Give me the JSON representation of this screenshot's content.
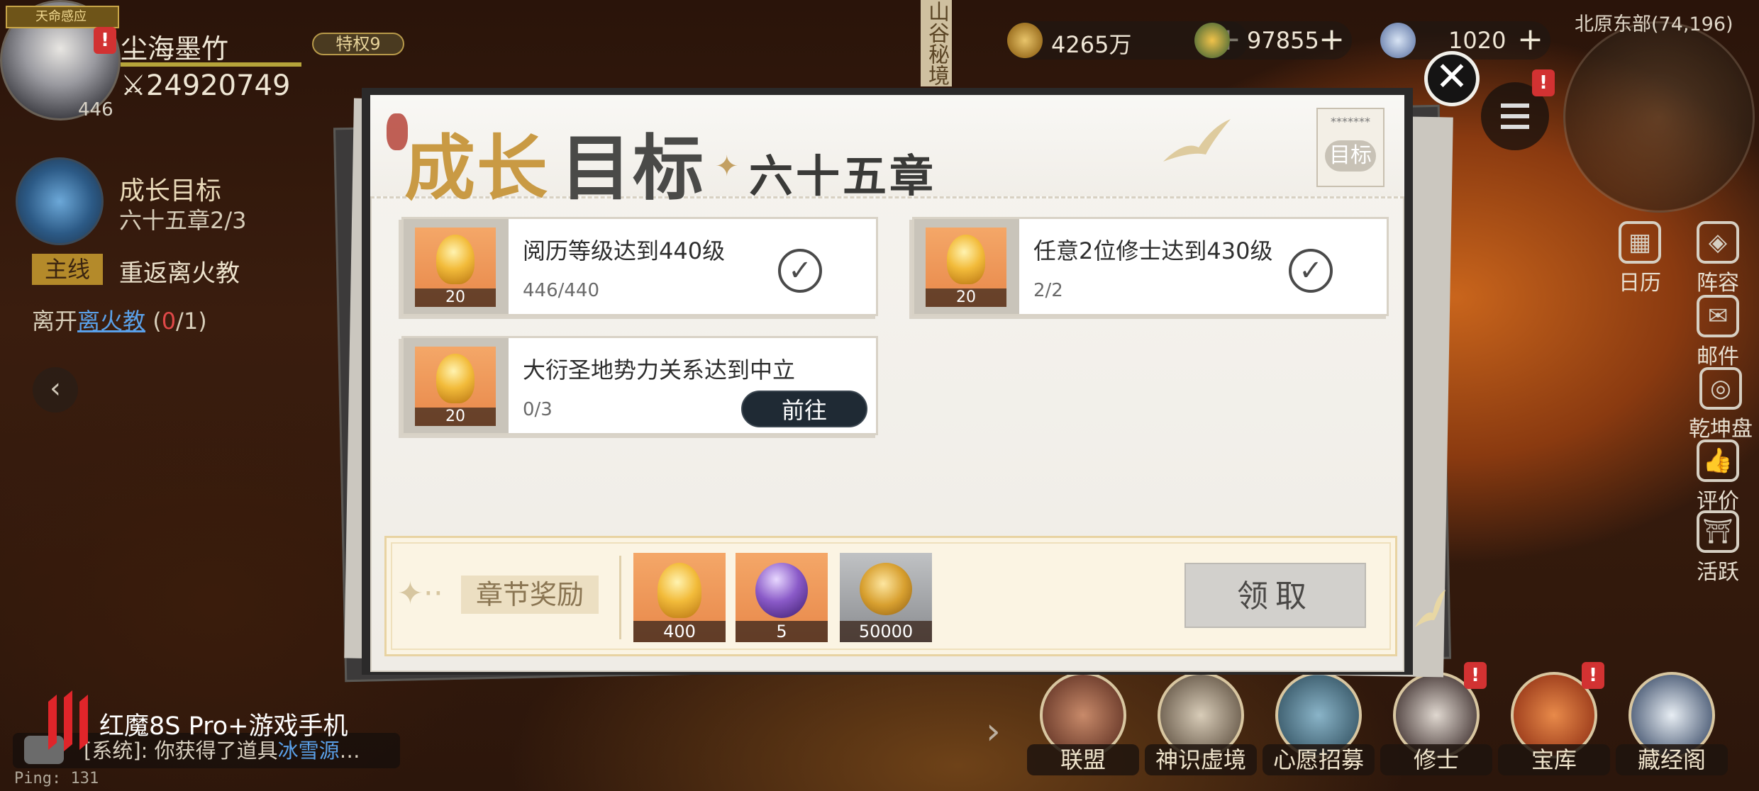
{
  "player": {
    "name": "尘海墨竹",
    "power": "24920749",
    "level": "446",
    "privilege": "特权9",
    "mini_badge": "天命感应"
  },
  "quest_tracker": {
    "title": "成长目标",
    "sub": "六十五章2/3",
    "main_tag": "主线",
    "main_text": "重返离火教",
    "leave_prefix": "离开",
    "leave_link": "离火教",
    "leave_count_open": "(",
    "leave_count_done": "0",
    "leave_count_rest": "/1)"
  },
  "top_bar": {
    "vertical_sign": "山谷秘境",
    "currency": [
      {
        "icon": "copper-coin-icon",
        "value": "4265万",
        "plus": "+"
      },
      {
        "icon": "spirit-stone-icon",
        "value": "97855",
        "plus": "+"
      },
      {
        "icon": "crystal-icon",
        "value": "1020",
        "plus": "+"
      }
    ],
    "location": "北原东部(74,196)",
    "alert": "!"
  },
  "side_menu": [
    {
      "icon": "calendar-icon",
      "glyph": "▦",
      "label": "日历"
    },
    {
      "icon": "formation-icon",
      "glyph": "◈",
      "label": "阵容"
    },
    {
      "icon": "mail-icon",
      "glyph": "✉",
      "label": "邮件"
    },
    {
      "icon": "universe-pouch-icon",
      "glyph": "◎",
      "label": "乾坤盘"
    },
    {
      "icon": "thumbs-up-icon",
      "glyph": "👍",
      "label": "评价"
    },
    {
      "icon": "pagoda-icon",
      "glyph": "⛩",
      "label": "活跃"
    }
  ],
  "bottom_menu": [
    {
      "name": "alliance",
      "label": "联盟",
      "color": "#8a4a3a"
    },
    {
      "name": "divine-sense",
      "label": "神识虚境",
      "color": "#7a6c5c"
    },
    {
      "name": "wish-recruit",
      "label": "心愿招募",
      "color": "#4a6a7a"
    },
    {
      "name": "cultivator",
      "label": "修士",
      "color": "#5a4c4a"
    },
    {
      "name": "treasury",
      "label": "宝库",
      "color": "#a8502a"
    },
    {
      "name": "scripture-pavilion",
      "label": "藏经阁",
      "color": "#5a6a84"
    }
  ],
  "chat": {
    "prefix": "[系统]: 你获得了道具",
    "item": "冰雪源",
    "ellipsis": "…"
  },
  "ping": "Ping: 131",
  "brand": "红魔8S Pro+游戏手机",
  "modal": {
    "title_a": "成长",
    "title_b": "目标",
    "star": "✦",
    "chapter": "六十五章",
    "stamp_stars": "*******",
    "stamp_text": "目标",
    "close": "✕",
    "tasks": [
      {
        "name": "阅历等级达到440级",
        "progress": "446/440",
        "reward_qty": "20",
        "status": "done",
        "check": "✓"
      },
      {
        "name": "任意2位修士达到430级",
        "progress": "2/2",
        "reward_qty": "20",
        "status": "done",
        "check": "✓"
      },
      {
        "name": "大衍圣地势力关系达到中立",
        "progress": "0/3",
        "reward_qty": "20",
        "status": "goto",
        "goto_label": "前往"
      }
    ],
    "chapter_reward": {
      "label": "章节奖励",
      "items": [
        {
          "icon": "golden-feather-icon",
          "qty": "400"
        },
        {
          "icon": "purple-egg-icon",
          "qty": "5"
        },
        {
          "icon": "gold-coin-icon",
          "qty": "50000"
        }
      ],
      "claim_label": "领取"
    }
  }
}
